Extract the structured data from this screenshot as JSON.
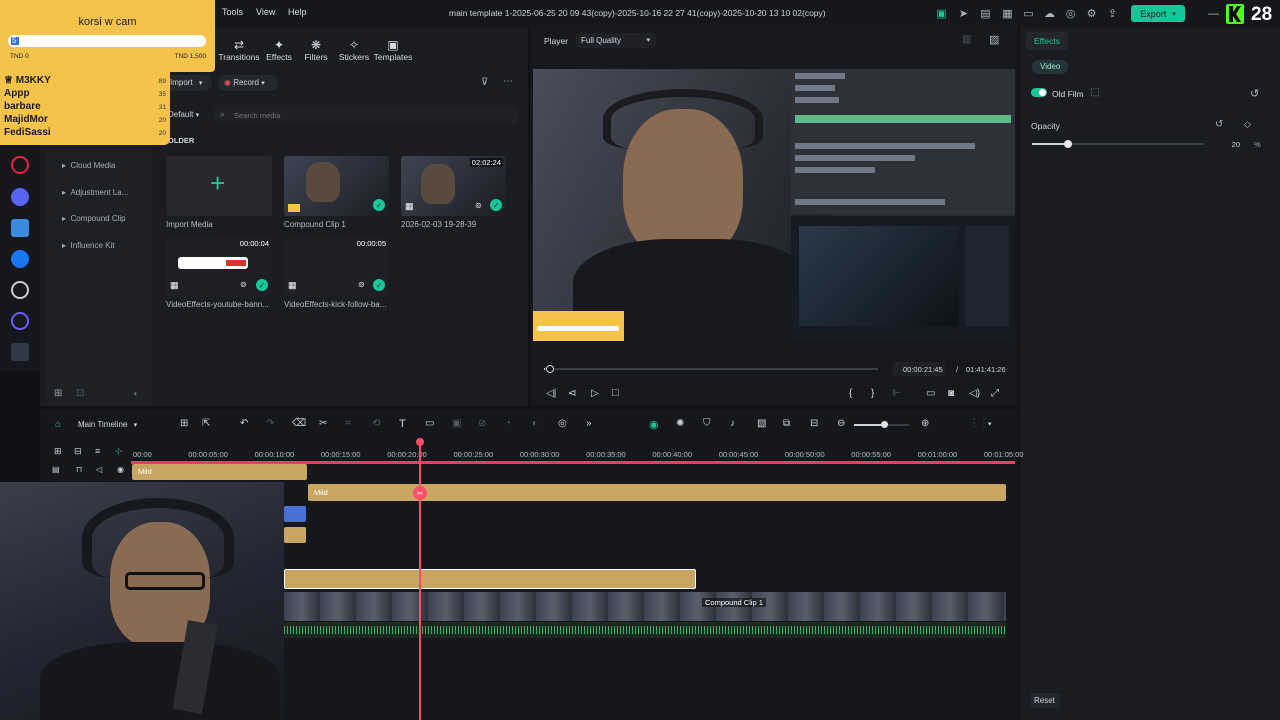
{
  "menu": {
    "tools": "Tools",
    "view": "View",
    "help": "Help"
  },
  "window_title": "main  template 1-2025-06-25 20 09 43(copy)-2025-10-16 22 27 41(copy)-2025-10-20 13 10 02(copy)",
  "export_label": "Export",
  "media_toolbar": [
    {
      "label": "Transitions",
      "icon": "transitions-icon"
    },
    {
      "label": "Effects",
      "icon": "effects-icon"
    },
    {
      "label": "Filters",
      "icon": "filters-icon"
    },
    {
      "label": "Stickers",
      "icon": "stickers-icon"
    },
    {
      "label": "Templates",
      "icon": "templates-icon"
    }
  ],
  "media": {
    "import_label": "Import",
    "record_label": "Record",
    "sort_label": "Default",
    "search_placeholder": "Search media",
    "folder_label": "OLDER",
    "side_items": [
      "Cloud Media",
      "Adjustment La...",
      "Compound Clip",
      "Influence Kit"
    ],
    "items": [
      {
        "label": "Import Media",
        "duration": ""
      },
      {
        "label": "Compound Clip 1",
        "duration": ""
      },
      {
        "label": "2026-02-03 19-28-39",
        "duration": "02:02:24"
      },
      {
        "label": "VideoEffects-youtube-bann...",
        "duration": "00:00:04"
      },
      {
        "label": "VideoEffects-kick-follow-ba...",
        "duration": "00:00:05"
      }
    ]
  },
  "player": {
    "tab": "Player",
    "quality": "Full Quality",
    "current_time": "00:00:21:45",
    "total_time": "01:41:41:26",
    "progress": 0.0036
  },
  "effects": {
    "tab": "Effects",
    "subtab": "Video",
    "effect_name": "Old Film",
    "opacity_label": "Opacity",
    "opacity_value": "20",
    "opacity_unit": "%",
    "opacity_level": 0.2,
    "reset_label": "Reset"
  },
  "timeline": {
    "label": "Main Timeline",
    "ticks": [
      "00:00",
      "00:00:05:00",
      "00:00:10:00",
      "00:00:15:00",
      "00:00:20:00",
      "00:00:25:00",
      "00:00:30:00",
      "00:00:35:00",
      "00:00:40:00",
      "00:00:45:00",
      "00:00:50:00",
      "00:00:55:00",
      "00:01:00:00",
      "00:01:05:00"
    ],
    "clip_mild_1": "Mild",
    "clip_mild_2": "Mild",
    "clip_compound": "Compound Clip 1"
  },
  "overlay": {
    "goal_title": "korsi w cam",
    "goal_min": "TND 0",
    "goal_max": "TND 1,500",
    "goal_input": "5",
    "leaderboard": [
      {
        "name": "M3KKY",
        "value": "89"
      },
      {
        "name": "Appp",
        "value": "35"
      },
      {
        "name": "barbare",
        "value": "31"
      },
      {
        "name": "MajidMor",
        "value": "20"
      },
      {
        "name": "FediSassi",
        "value": "20"
      }
    ],
    "kick_count": "28"
  },
  "colors": {
    "accent": "#16c59a",
    "clip_gold": "#c8a560",
    "playhead": "#ff4d6a",
    "overlay_yellow": "#f5c24a"
  }
}
